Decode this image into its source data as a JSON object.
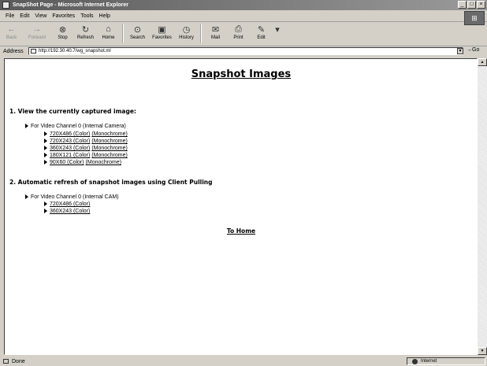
{
  "window": {
    "title": "SnapShot Page - Microsoft Internet Explorer",
    "controls": [
      "_",
      "□",
      "×"
    ]
  },
  "menu": [
    {
      "label": "File",
      "key": "F"
    },
    {
      "label": "Edit",
      "key": "E"
    },
    {
      "label": "View",
      "key": "V"
    },
    {
      "label": "Favorites",
      "key": "a"
    },
    {
      "label": "Tools",
      "key": "T"
    },
    {
      "label": "Help",
      "key": "H"
    }
  ],
  "toolbar": {
    "back": {
      "label": "Back",
      "icon": "back-arrow-icon"
    },
    "forward": {
      "label": "Forward",
      "icon": "forward-arrow-icon"
    },
    "stop": {
      "label": "Stop",
      "icon": "stop-icon"
    },
    "refresh": {
      "label": "Refresh",
      "icon": "refresh-icon"
    },
    "home": {
      "label": "Home",
      "icon": "home-icon"
    },
    "search": {
      "label": "Search",
      "icon": "search-icon"
    },
    "favorites": {
      "label": "Favorites",
      "icon": "favorites-icon"
    },
    "history": {
      "label": "History",
      "icon": "history-icon"
    },
    "mail": {
      "label": "Mail",
      "icon": "mail-icon"
    },
    "print": {
      "label": "Print",
      "icon": "print-icon"
    },
    "edit": {
      "label": "Edit",
      "icon": "edit-icon"
    }
  },
  "address": {
    "label": "Address",
    "url": "http://192.30.40.7/wg_snapshot.ml",
    "go_label": "Go"
  },
  "page": {
    "title": "Snapshot Images",
    "section1": {
      "heading": "1. View the currently captured image:",
      "channel": "For Video Channel 0 (Internal Camera)",
      "rows": [
        {
          "color": "720X486 (Color)",
          "mono": "(Monochrome)"
        },
        {
          "color": "720X243 (Color)",
          "mono": "(Monochrome)"
        },
        {
          "color": "360X243 (Color)",
          "mono": "(Monochrome)"
        },
        {
          "color": "180X121 (Color)",
          "mono": "(Monochrome)"
        },
        {
          "color": "90X60 (Color)",
          "mono": "(Monochrome)"
        }
      ]
    },
    "section2": {
      "heading": "2. Automatic refresh of snapshot images using Client Pulling",
      "channel": "For Video Channel 0 (Internal CAM)",
      "rows": [
        {
          "color": "720X486 (Color)"
        },
        {
          "color": "360X243 (Color)"
        }
      ]
    },
    "home_link": "To Home"
  },
  "status": {
    "text": "Done",
    "zone": "Internet"
  }
}
